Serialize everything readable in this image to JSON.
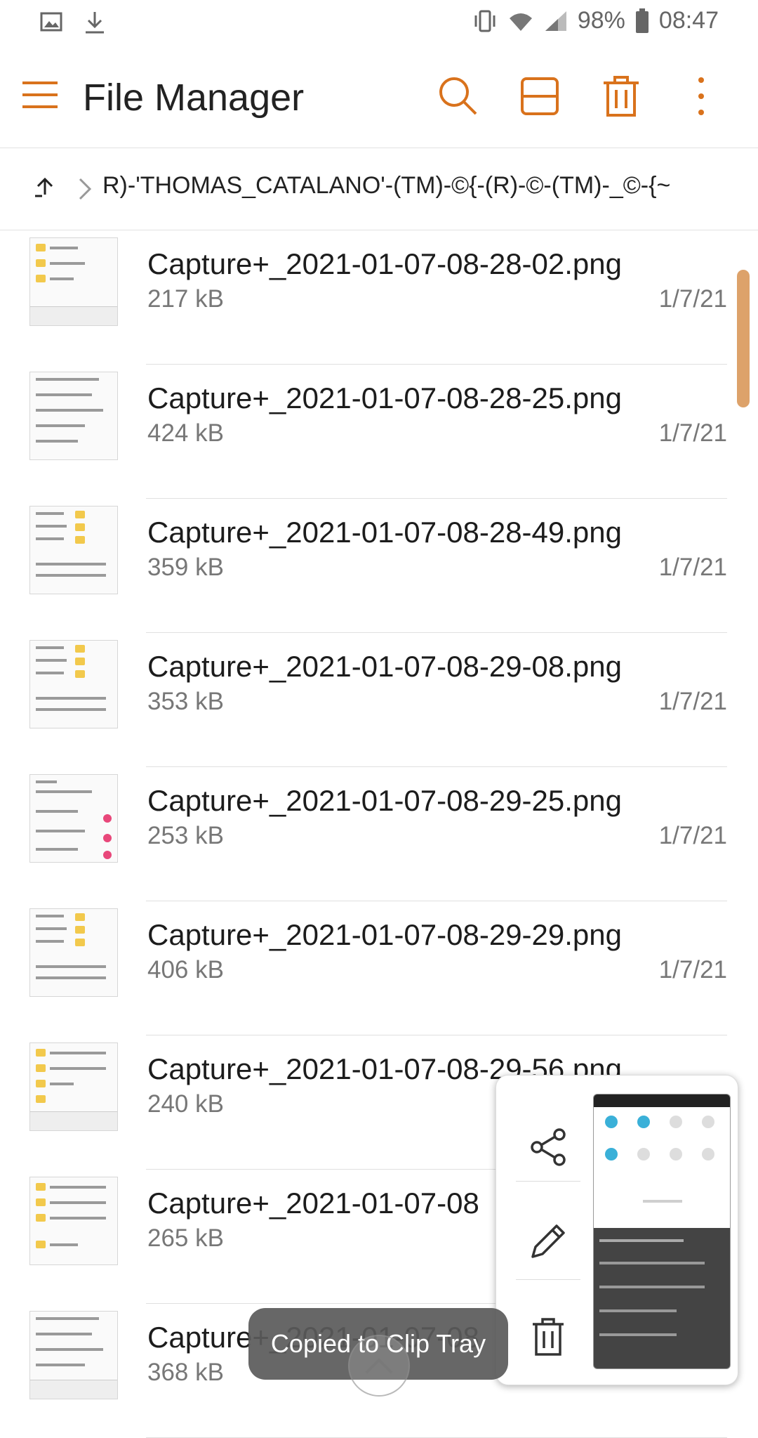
{
  "status_bar": {
    "icons_left": [
      "image-icon",
      "download-icon"
    ],
    "icons_right": [
      "vibrate-icon",
      "wifi-icon",
      "signal-icon"
    ],
    "battery": "98%",
    "time": "08:47"
  },
  "app_bar": {
    "title": "File Manager",
    "actions": [
      "search-icon",
      "view-toggle-icon",
      "delete-icon",
      "more-icon"
    ],
    "accent_color": "#d9721c"
  },
  "breadcrumb": {
    "path": "R)-'THOMAS_CATALANO'-(TM)-©{-(R)-©-(TM)-_©-{~"
  },
  "files": [
    {
      "name": "Capture+_2021-01-07-08-28-02.png",
      "size": "217 kB",
      "date": "1/7/21"
    },
    {
      "name": "Capture+_2021-01-07-08-28-25.png",
      "size": "424 kB",
      "date": "1/7/21"
    },
    {
      "name": "Capture+_2021-01-07-08-28-49.png",
      "size": "359 kB",
      "date": "1/7/21"
    },
    {
      "name": "Capture+_2021-01-07-08-29-08.png",
      "size": "353 kB",
      "date": "1/7/21"
    },
    {
      "name": "Capture+_2021-01-07-08-29-25.png",
      "size": "253 kB",
      "date": "1/7/21"
    },
    {
      "name": "Capture+_2021-01-07-08-29-29.png",
      "size": "406 kB",
      "date": "1/7/21"
    },
    {
      "name": "Capture+_2021-01-07-08-29-56.png",
      "size": "240 kB",
      "date": ""
    },
    {
      "name": "Capture+_2021-01-07-08",
      "size": "265 kB",
      "date": ""
    },
    {
      "name": "Capture+_2021-01-07-08",
      "size": "368 kB",
      "date": ""
    }
  ],
  "preview_panel": {
    "actions": [
      "share-icon",
      "edit-icon",
      "delete-icon"
    ]
  },
  "toast": {
    "message": "Copied to Clip Tray"
  }
}
